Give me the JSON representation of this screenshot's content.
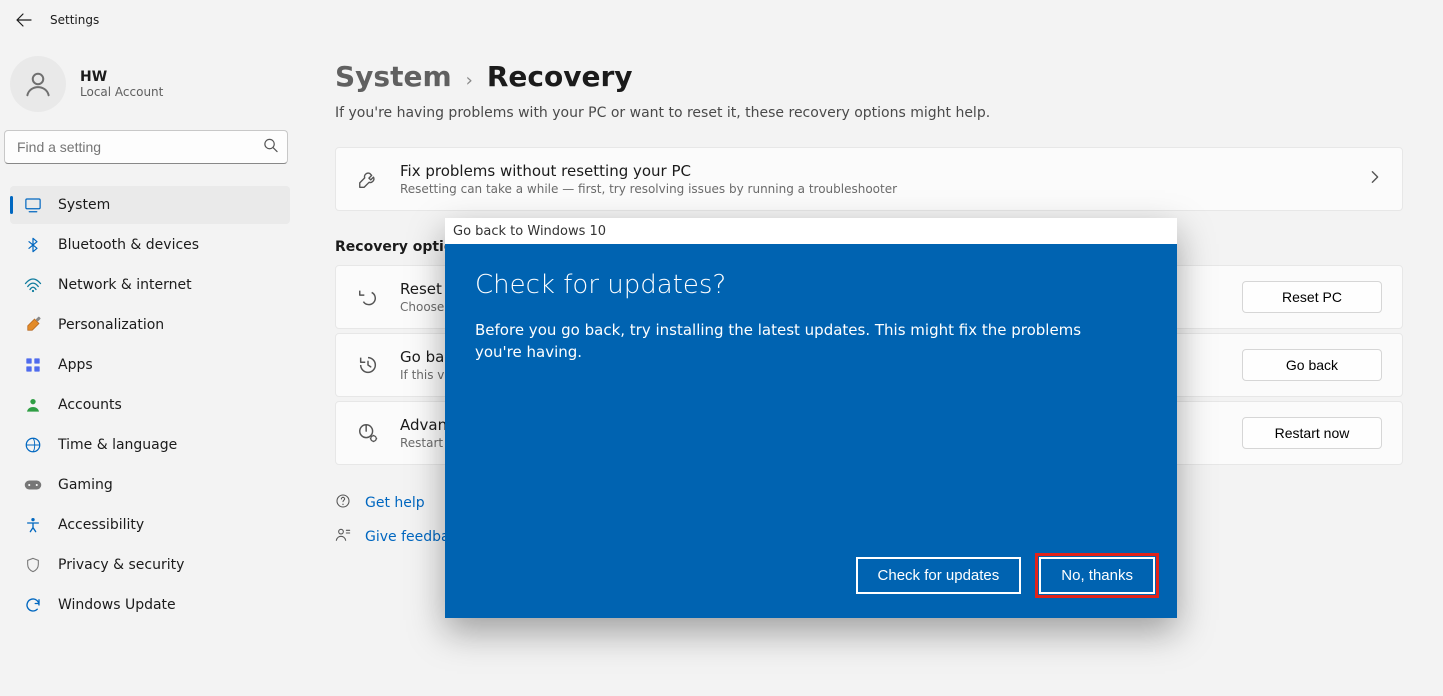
{
  "titlebar": {
    "title": "Settings"
  },
  "user": {
    "name": "HW",
    "subtitle": "Local Account"
  },
  "search": {
    "placeholder": "Find a setting"
  },
  "sidebar": {
    "items": [
      {
        "label": "System"
      },
      {
        "label": "Bluetooth & devices"
      },
      {
        "label": "Network & internet"
      },
      {
        "label": "Personalization"
      },
      {
        "label": "Apps"
      },
      {
        "label": "Accounts"
      },
      {
        "label": "Time & language"
      },
      {
        "label": "Gaming"
      },
      {
        "label": "Accessibility"
      },
      {
        "label": "Privacy & security"
      },
      {
        "label": "Windows Update"
      }
    ],
    "selected_index": 0
  },
  "breadcrumb": {
    "parent": "System",
    "current": "Recovery"
  },
  "main": {
    "subhead": "If you're having problems with your PC or want to reset it, these recovery options might help.",
    "troubleshoot_card": {
      "title": "Fix problems without resetting your PC",
      "subtitle": "Resetting can take a while — first, try resolving issues by running a troubleshooter"
    },
    "recovery_label": "Recovery options",
    "rows": [
      {
        "title": "Reset this PC",
        "subtitle": "Choose to keep or remove your personal files, then reinstall Windows",
        "button": "Reset PC"
      },
      {
        "title": "Go back",
        "subtitle": "If this version isn't working, try going back to Windows 10",
        "button": "Go back"
      },
      {
        "title": "Advanced startup",
        "subtitle": "Restart your device to change startup settings, including starting from a disc or USB drive",
        "button": "Restart now"
      }
    ],
    "links": {
      "help": "Get help",
      "feedback": "Give feedback"
    }
  },
  "dialog": {
    "window_title": "Go back to Windows 10",
    "heading": "Check for updates?",
    "body": "Before you go back, try installing the latest updates. This might fix the problems you're having.",
    "primary": "Check for updates",
    "secondary": "No, thanks"
  }
}
